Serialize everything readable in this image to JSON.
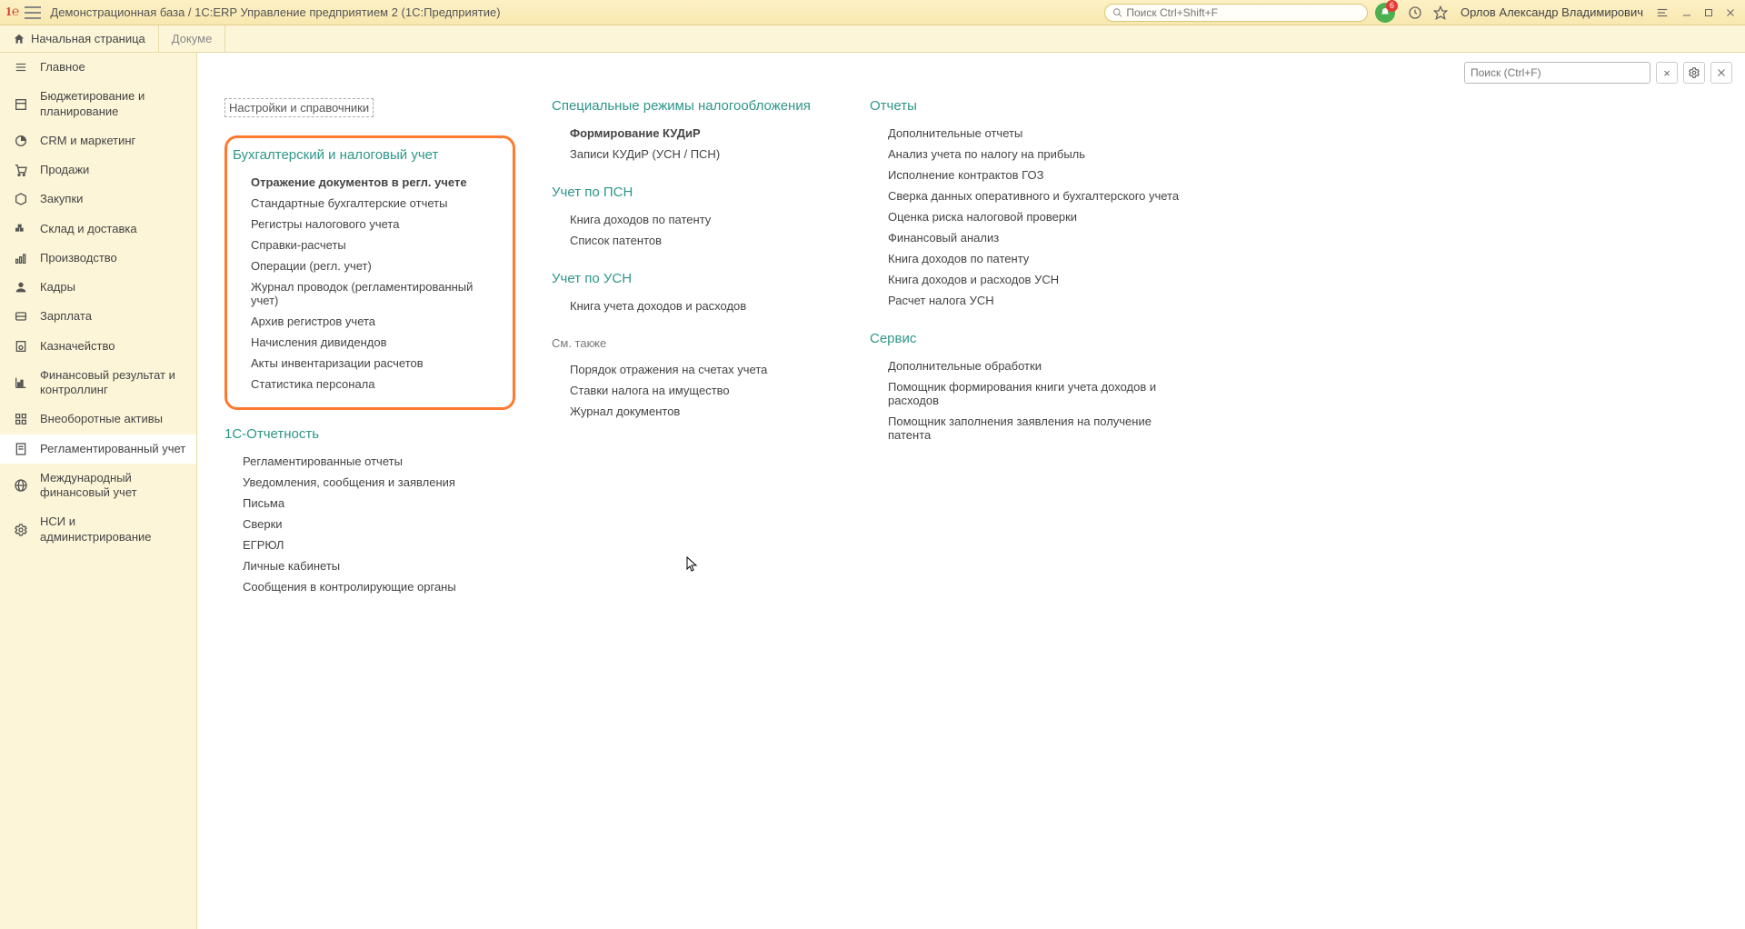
{
  "titlebar": {
    "app_title": "Демонстрационная база / 1С:ERP Управление предприятием 2  (1С:Предприятие)",
    "search_placeholder": "Поиск Ctrl+Shift+F",
    "notification_count": "6",
    "username": "Орлов Александр Владимирович"
  },
  "tabs": {
    "home": "Начальная страница",
    "partial": "Докуме"
  },
  "sidebar": [
    {
      "label": "Главное"
    },
    {
      "label": "Бюджетирование и планирование"
    },
    {
      "label": "CRM и маркетинг"
    },
    {
      "label": "Продажи"
    },
    {
      "label": "Закупки"
    },
    {
      "label": "Склад и доставка"
    },
    {
      "label": "Производство"
    },
    {
      "label": "Кадры"
    },
    {
      "label": "Зарплата"
    },
    {
      "label": "Казначейство"
    },
    {
      "label": "Финансовый результат и контроллинг"
    },
    {
      "label": "Внеоборотные активы"
    },
    {
      "label": "Регламентированный учет"
    },
    {
      "label": "Международный финансовый учет"
    },
    {
      "label": "НСИ и администрирование"
    }
  ],
  "content": {
    "search_placeholder": "Поиск (Ctrl+F)",
    "clear": "×",
    "settings_link": "Настройки и справочники",
    "col1": {
      "sec1": {
        "title": "Бухгалтерский и налоговый учет",
        "items": [
          {
            "label": "Отражение документов в регл. учете",
            "bold": true
          },
          {
            "label": "Стандартные бухгалтерские отчеты"
          },
          {
            "label": "Регистры налогового учета"
          },
          {
            "label": "Справки-расчеты"
          },
          {
            "label": "Операции (регл. учет)"
          },
          {
            "label": "Журнал проводок (регламентированный учет)"
          },
          {
            "label": "Архив регистров учета"
          },
          {
            "label": "Начисления дивидендов"
          },
          {
            "label": "Акты инвентаризации расчетов"
          },
          {
            "label": "Статистика персонала"
          }
        ]
      },
      "sec2": {
        "title": "1С-Отчетность",
        "items": [
          {
            "label": "Регламентированные отчеты"
          },
          {
            "label": "Уведомления, сообщения и заявления"
          },
          {
            "label": "Письма"
          },
          {
            "label": "Сверки"
          },
          {
            "label": "ЕГРЮЛ"
          },
          {
            "label": "Личные кабинеты"
          },
          {
            "label": "Сообщения в контролирующие органы"
          }
        ]
      }
    },
    "col2": {
      "sec1": {
        "title": "Специальные режимы налогообложения",
        "items": [
          {
            "label": "Формирование КУДиР",
            "bold": true
          },
          {
            "label": "Записи КУДиР (УСН / ПСН)"
          }
        ]
      },
      "sec2": {
        "title": "Учет по ПСН",
        "items": [
          {
            "label": "Книга доходов по патенту"
          },
          {
            "label": "Список патентов"
          }
        ]
      },
      "sec3": {
        "title": "Учет по УСН",
        "items": [
          {
            "label": "Книга учета доходов и расходов"
          }
        ]
      },
      "sec4": {
        "title": "См. также",
        "items": [
          {
            "label": "Порядок отражения на счетах учета"
          },
          {
            "label": "Ставки налога на имущество"
          },
          {
            "label": "Журнал документов"
          }
        ]
      }
    },
    "col3": {
      "sec1": {
        "title": "Отчеты",
        "items": [
          {
            "label": "Дополнительные отчеты"
          },
          {
            "label": "Анализ учета по налогу на прибыль"
          },
          {
            "label": "Исполнение контрактов ГОЗ"
          },
          {
            "label": "Сверка данных оперативного и бухгалтерского учета"
          },
          {
            "label": "Оценка риска налоговой проверки"
          },
          {
            "label": "Финансовый анализ"
          },
          {
            "label": "Книга доходов по патенту"
          },
          {
            "label": "Книга доходов и расходов УСН"
          },
          {
            "label": "Расчет налога УСН"
          }
        ]
      },
      "sec2": {
        "title": "Сервис",
        "items": [
          {
            "label": "Дополнительные обработки"
          },
          {
            "label": "Помощник формирования книги учета доходов и расходов"
          },
          {
            "label": "Помощник заполнения заявления на получение патента"
          }
        ]
      }
    }
  }
}
